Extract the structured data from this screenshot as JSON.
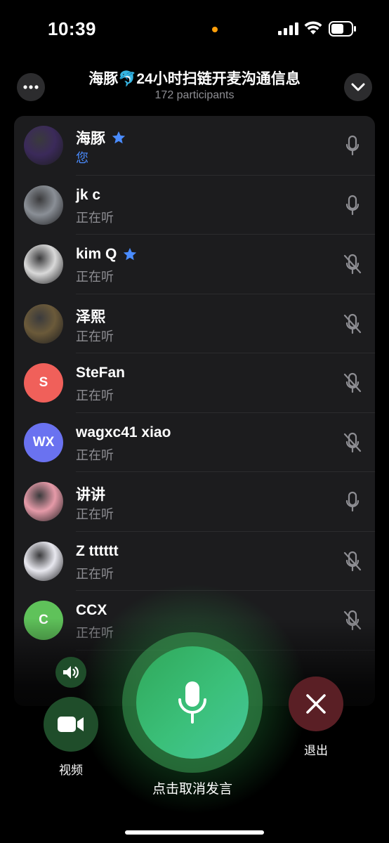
{
  "status_bar": {
    "time": "10:39",
    "icons": [
      "signal-icon",
      "wifi-icon",
      "battery-icon"
    ],
    "dot_color": "#ff9f0a"
  },
  "header": {
    "title": "海豚🐬24小时扫链开麦沟通信息",
    "subtitle": "172 participants",
    "left_icon": "more-icon",
    "right_icon": "chevron-down-icon"
  },
  "participants": [
    {
      "name": "海豚",
      "status": "您",
      "star": true,
      "mic": "on",
      "avatar": "photo",
      "avatar_color": "#3b2a5a"
    },
    {
      "name": "jk c",
      "status": "正在听",
      "star": false,
      "mic": "on",
      "avatar": "photo",
      "avatar_color": "#8a8f96"
    },
    {
      "name": "kim Q",
      "status": "正在听",
      "star": true,
      "mic": "muted",
      "avatar": "photo",
      "avatar_color": "#d9d9d9"
    },
    {
      "name": "泽熙",
      "status": "正在听",
      "star": false,
      "mic": "muted",
      "avatar": "photo",
      "avatar_color": "#6b5a3a"
    },
    {
      "name": "SteFan",
      "status": "正在听",
      "star": false,
      "mic": "muted",
      "avatar_initials": "S",
      "avatar_color": "#f0605a"
    },
    {
      "name": "wagxc41 xiao",
      "status": "正在听",
      "star": false,
      "mic": "muted",
      "avatar_initials": "WX",
      "avatar_color": "#6a72f0"
    },
    {
      "name": "讲讲",
      "status": "正在听",
      "star": false,
      "mic": "on",
      "avatar": "photo",
      "avatar_color": "#e59aa8"
    },
    {
      "name": "Z tttttt",
      "status": "正在听",
      "star": false,
      "mic": "muted",
      "avatar": "photo",
      "avatar_color": "#e8e8ef"
    },
    {
      "name": "CCX",
      "status": "正在听",
      "star": false,
      "mic": "muted",
      "avatar_initials": "C",
      "avatar_color": "#5fc25a"
    }
  ],
  "controls": {
    "speaker_icon": "speaker-icon",
    "video_label": "视频",
    "mic_label": "点击取消发言",
    "leave_label": "退出",
    "accent": "#34c759",
    "leave_color": "#5a1f25"
  }
}
